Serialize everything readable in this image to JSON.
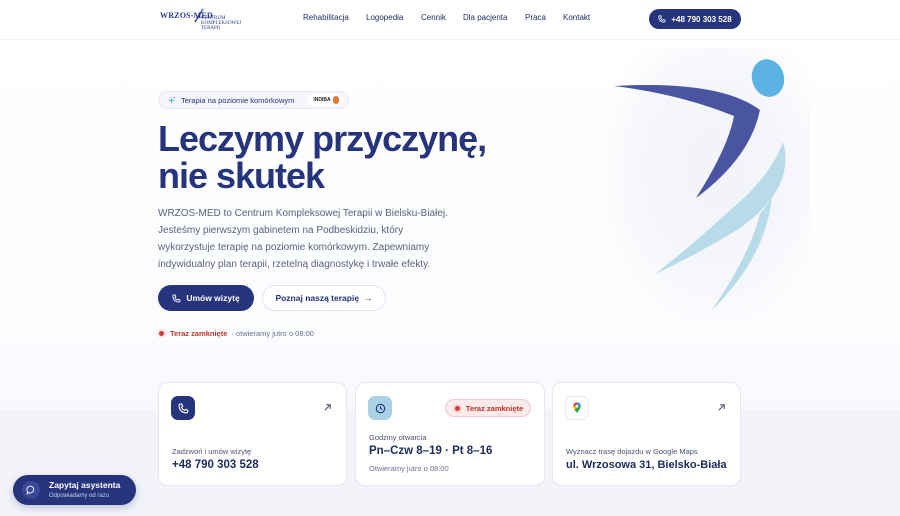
{
  "brand": {
    "logo_main": "WRZOS-MED",
    "logo_sub": "Centrum Kompleksowej Terapii"
  },
  "nav": {
    "items": [
      "Rehabilitacja",
      "Logopedia",
      "Cennik",
      "Dla pacjenta",
      "Praca",
      "Kontakt"
    ],
    "phone_label": "+48 790 303 528"
  },
  "hero": {
    "badge_text": "Terapia na poziomie komórkowym",
    "badge_logo": "INDIBA",
    "headline_line1": "Leczymy przyczynę,",
    "headline_line2": "nie skutek",
    "lead_line1": "WRZOS-MED to Centrum Kompleksowej Terapii w Bielsku-Białej.",
    "lead_line2": "Jesteśmy pierwszym gabinetem na Podbeskidziu, który",
    "lead_line3": "wykorzystuje terapię na poziomie komórkowym. Zapewniamy",
    "lead_line4": "indywidualny plan terapii, rzetelną diagnostykę i trwałe efekty.",
    "primary_cta": "Umów wizytę",
    "secondary_cta": "Poznaj naszą terapię",
    "status_strong": "Teraz zamknięte",
    "status_rest": "· otwieramy jutro o 08:00"
  },
  "cards": {
    "call": {
      "label": "Zadzwoń i umów wizytę",
      "value": "+48 790 303 528"
    },
    "hours": {
      "badge": "Teraz zamknięte",
      "label": "Godziny otwarcia",
      "value": "Pn–Czw 8–19 · Pt 8–16",
      "note": "Otwieramy jutro o 08:00"
    },
    "route": {
      "label": "Wyznacz trasę dojazdu w Google Maps",
      "value": "ul. Wrzosowa 31, Bielsko-Biała"
    }
  },
  "assistant": {
    "title": "Zapytaj asystenta",
    "subtitle": "Odpowiadamy od razu"
  },
  "colors": {
    "primary": "#26337d",
    "accent_light": "#b8dbe9",
    "accent_blue": "#5bb3e4",
    "status_red": "#d83a3a"
  }
}
